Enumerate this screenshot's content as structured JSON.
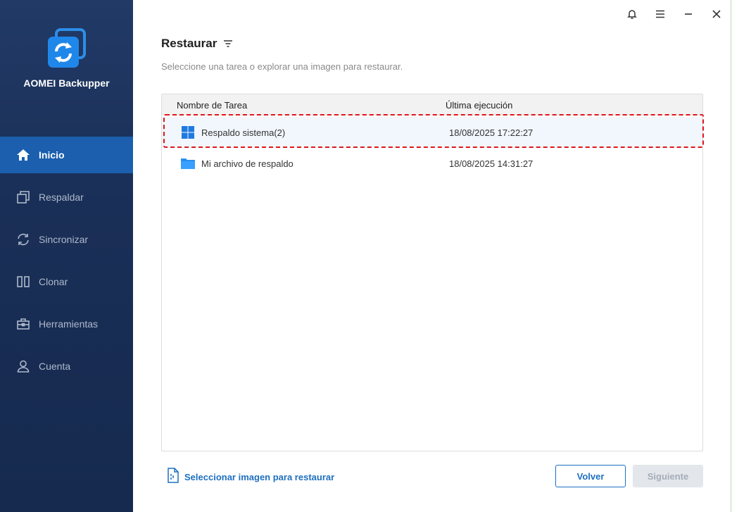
{
  "app": {
    "name": "AOMEI Backupper"
  },
  "sidebar": {
    "items": [
      {
        "label": "Inicio",
        "icon": "home-icon",
        "active": true
      },
      {
        "label": "Respaldar",
        "icon": "backup-icon",
        "active": false
      },
      {
        "label": "Sincronizar",
        "icon": "sync-icon",
        "active": false
      },
      {
        "label": "Clonar",
        "icon": "clone-icon",
        "active": false
      },
      {
        "label": "Herramientas",
        "icon": "toolbox-icon",
        "active": false
      },
      {
        "label": "Cuenta",
        "icon": "user-icon",
        "active": false
      }
    ]
  },
  "titlebar": {
    "icons": [
      "bell-icon",
      "menu-icon",
      "minimize-icon",
      "close-icon"
    ]
  },
  "main": {
    "title": "Restaurar",
    "subtitle": "Seleccione una tarea o explorar una imagen para restaurar.",
    "table": {
      "columns": [
        "Nombre de Tarea",
        "Última ejecución"
      ],
      "rows": [
        {
          "name": "Respaldo sistema(2)",
          "date": "18/08/2025 17:22:27",
          "icon": "windows-icon",
          "selected": true
        },
        {
          "name": "Mi archivo de respaldo",
          "date": "18/08/2025 14:31:27",
          "icon": "folder-icon",
          "selected": false
        }
      ]
    }
  },
  "footer": {
    "select_image_label": "Seleccionar imagen para restaurar",
    "back_label": "Volver",
    "next_label": "Siguiente"
  },
  "colors": {
    "sidebar_bg": "#1a2f57",
    "active_nav": "#1b5fae",
    "accent": "#1e6fbf",
    "highlight_border": "#e0161b"
  }
}
